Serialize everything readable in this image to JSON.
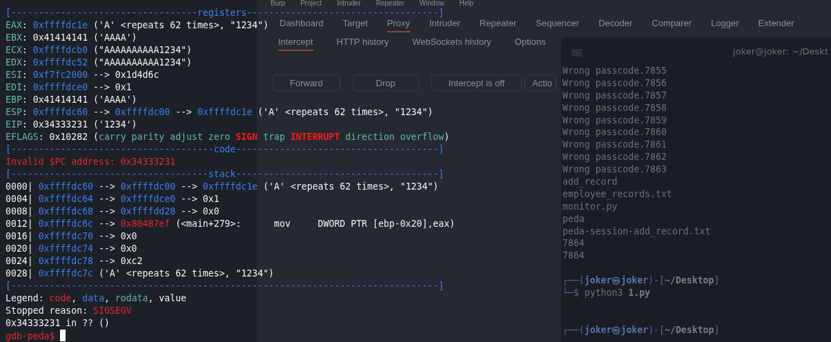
{
  "burp_window": {
    "menu": [
      "Burp",
      "Project",
      "Intruder",
      "Repeater",
      "Window",
      "Help"
    ],
    "tabs": [
      {
        "label": "Dashboard",
        "selected": false
      },
      {
        "label": "Target",
        "selected": false
      },
      {
        "label": "Proxy",
        "selected": true
      },
      {
        "label": "Intruder",
        "selected": false
      },
      {
        "label": "Repeater",
        "selected": false
      },
      {
        "label": "Sequencer",
        "selected": false
      },
      {
        "label": "Decoder",
        "selected": false
      },
      {
        "label": "Comparer",
        "selected": false
      },
      {
        "label": "Logger",
        "selected": false
      },
      {
        "label": "Extender",
        "selected": false
      }
    ],
    "subtabs": [
      {
        "label": "Intercept",
        "selected": true
      },
      {
        "label": "HTTP history",
        "selected": false
      },
      {
        "label": "WebSockets history",
        "selected": false
      },
      {
        "label": "Options",
        "selected": false
      }
    ],
    "buttons": [
      "Forward",
      "Drop",
      "Intercept is off",
      "Actio"
    ]
  },
  "shell_window": {
    "title": "joker@joker: ~/Deskt",
    "blocks": [
      {
        "lines": [
          {
            "segments": [
              {
                "text": "Wrong passcode.7855",
                "kind": "plain"
              }
            ]
          },
          {
            "segments": [
              {
                "text": "Wrong passcode.7856",
                "kind": "plain"
              }
            ]
          },
          {
            "segments": [
              {
                "text": "Wrong passcode.7857",
                "kind": "plain"
              }
            ]
          },
          {
            "segments": [
              {
                "text": "Wrong passcode.7858",
                "kind": "plain"
              }
            ]
          },
          {
            "segments": [
              {
                "text": "Wrong passcode.7859",
                "kind": "plain"
              }
            ]
          },
          {
            "segments": [
              {
                "text": "Wrong passcode.7860",
                "kind": "plain"
              }
            ]
          },
          {
            "segments": [
              {
                "text": "Wrong passcode.7861",
                "kind": "plain"
              }
            ]
          },
          {
            "segments": [
              {
                "text": "Wrong passcode.7862",
                "kind": "plain"
              }
            ]
          },
          {
            "segments": [
              {
                "text": "Wrong passcode.7863",
                "kind": "plain"
              }
            ]
          },
          {
            "segments": [
              {
                "text": "add_record",
                "kind": "plain"
              }
            ]
          },
          {
            "segments": [
              {
                "text": "employee_records.txt",
                "kind": "plain"
              }
            ]
          },
          {
            "segments": [
              {
                "text": "monitor.py",
                "kind": "plain"
              }
            ]
          },
          {
            "segments": [
              {
                "text": "peda",
                "kind": "plain"
              }
            ]
          },
          {
            "segments": [
              {
                "text": "peda-session-add_record.txt",
                "kind": "plain"
              }
            ]
          },
          {
            "segments": [
              {
                "text": "7864",
                "kind": "plain"
              }
            ]
          },
          {
            "segments": [
              {
                "text": "7864",
                "kind": "plain"
              }
            ]
          }
        ]
      },
      {
        "lines": [
          {
            "segments": [
              {
                "text": "┌──(",
                "kind": "prompt"
              },
              {
                "text": "joker㉿joker",
                "kind": "user"
              },
              {
                "text": ")-[",
                "kind": "prompt"
              },
              {
                "text": "~/Desktop",
                "kind": "path"
              },
              {
                "text": "]",
                "kind": "prompt"
              }
            ]
          },
          {
            "segments": [
              {
                "text": "└─$ ",
                "kind": "prompt"
              },
              {
                "text": "python3 ",
                "kind": "plain"
              },
              {
                "text": "1.py",
                "kind": "path"
              }
            ]
          }
        ]
      },
      {
        "lines": [
          {
            "segments": [
              {
                "text": "┌──(",
                "kind": "prompt"
              },
              {
                "text": "joker㉿joker",
                "kind": "user"
              },
              {
                "text": ")-[",
                "kind": "prompt"
              },
              {
                "text": "~/Desktop",
                "kind": "path"
              },
              {
                "text": "]",
                "kind": "prompt"
              }
            ]
          }
        ]
      }
    ]
  },
  "gdb_terminal": {
    "lines": [
      {
        "segments": [
          {
            "text": "[----------------------------------registers-----------------------------------]",
            "kind": "header"
          }
        ]
      },
      {
        "segments": [
          {
            "text": "EAX",
            "kind": "label"
          },
          {
            "text": ": ",
            "kind": "plain"
          },
          {
            "text": "0xffffdc1e",
            "kind": "addr"
          },
          {
            "text": " ('A' <repeats 62 times>, \"1234\")",
            "kind": "plain"
          }
        ]
      },
      {
        "segments": [
          {
            "text": "EBX",
            "kind": "label"
          },
          {
            "text": ": 0x41414141 ('AAAA')",
            "kind": "plain"
          }
        ]
      },
      {
        "segments": [
          {
            "text": "ECX",
            "kind": "label"
          },
          {
            "text": ": ",
            "kind": "plain"
          },
          {
            "text": "0xffffdcb0",
            "kind": "addr"
          },
          {
            "text": " (\"AAAAAAAAAA1234\")",
            "kind": "plain"
          }
        ]
      },
      {
        "segments": [
          {
            "text": "EDX",
            "kind": "label"
          },
          {
            "text": ": ",
            "kind": "plain"
          },
          {
            "text": "0xffffdc52",
            "kind": "addr"
          },
          {
            "text": " (\"AAAAAAAAAA1234\")",
            "kind": "plain"
          }
        ]
      },
      {
        "segments": [
          {
            "text": "ESI",
            "kind": "label"
          },
          {
            "text": ": ",
            "kind": "plain"
          },
          {
            "text": "0xf7fc2000",
            "kind": "addr"
          },
          {
            "text": " --> 0x1d4d6c",
            "kind": "plain"
          }
        ]
      },
      {
        "segments": [
          {
            "text": "EDI",
            "kind": "label"
          },
          {
            "text": ": ",
            "kind": "plain"
          },
          {
            "text": "0xffffdce0",
            "kind": "addr"
          },
          {
            "text": " --> 0x1",
            "kind": "plain"
          }
        ]
      },
      {
        "segments": [
          {
            "text": "EBP",
            "kind": "label"
          },
          {
            "text": ": 0x41414141 ('AAAA')",
            "kind": "plain"
          }
        ]
      },
      {
        "segments": [
          {
            "text": "ESP",
            "kind": "label"
          },
          {
            "text": ": ",
            "kind": "plain"
          },
          {
            "text": "0xffffdc60",
            "kind": "addr"
          },
          {
            "text": " --> ",
            "kind": "plain"
          },
          {
            "text": "0xffffdc00",
            "kind": "addr"
          },
          {
            "text": " --> ",
            "kind": "plain"
          },
          {
            "text": "0xffffdc1e",
            "kind": "addr"
          },
          {
            "text": " ('A' <repeats 62 times>, \"1234\")",
            "kind": "plain"
          }
        ]
      },
      {
        "segments": [
          {
            "text": "EIP",
            "kind": "label"
          },
          {
            "text": ": 0x34333231 ('1234')",
            "kind": "plain"
          }
        ]
      },
      {
        "segments": [
          {
            "text": "EFLAGS",
            "kind": "label"
          },
          {
            "text": ": 0x10282 (",
            "kind": "plain"
          },
          {
            "text": "carry parity adjust zero ",
            "kind": "rodata"
          },
          {
            "text": "SIGN",
            "kind": "flag"
          },
          {
            "text": " trap ",
            "kind": "rodata"
          },
          {
            "text": "INTERRUPT",
            "kind": "flag"
          },
          {
            "text": " direction overflow",
            "kind": "rodata"
          },
          {
            "text": ")",
            "kind": "plain"
          }
        ]
      },
      {
        "segments": [
          {
            "text": "[-------------------------------------code-------------------------------------]",
            "kind": "header"
          }
        ]
      },
      {
        "segments": [
          {
            "text": "Invalid $PC address: 0x34333231",
            "kind": "code"
          }
        ]
      },
      {
        "segments": [
          {
            "text": "[------------------------------------stack-------------------------------------]",
            "kind": "header"
          }
        ]
      },
      {
        "segments": [
          {
            "text": "0000| ",
            "kind": "plain"
          },
          {
            "text": "0xffffdc60",
            "kind": "addr"
          },
          {
            "text": " --> ",
            "kind": "plain"
          },
          {
            "text": "0xffffdc00",
            "kind": "addr"
          },
          {
            "text": " --> ",
            "kind": "plain"
          },
          {
            "text": "0xffffdc1e",
            "kind": "addr"
          },
          {
            "text": " ('A' <repeats 62 times>, \"1234\")",
            "kind": "plain"
          }
        ]
      },
      {
        "segments": [
          {
            "text": "0004| ",
            "kind": "plain"
          },
          {
            "text": "0xffffdc64",
            "kind": "addr"
          },
          {
            "text": " --> ",
            "kind": "plain"
          },
          {
            "text": "0xffffdce0",
            "kind": "addr"
          },
          {
            "text": " --> 0x1",
            "kind": "plain"
          }
        ]
      },
      {
        "segments": [
          {
            "text": "0008| ",
            "kind": "plain"
          },
          {
            "text": "0xffffdc68",
            "kind": "addr"
          },
          {
            "text": " --> ",
            "kind": "plain"
          },
          {
            "text": "0xffffdd28",
            "kind": "addr"
          },
          {
            "text": " --> 0x0",
            "kind": "plain"
          }
        ]
      },
      {
        "segments": [
          {
            "text": "0012| ",
            "kind": "plain"
          },
          {
            "text": "0xffffdc6c",
            "kind": "addr"
          },
          {
            "text": " --> ",
            "kind": "plain"
          },
          {
            "text": "0x80487ef",
            "kind": "code"
          },
          {
            "text": " (<main+279>:      mov     DWORD PTR [ebp-0x20],eax)",
            "kind": "plain"
          }
        ]
      },
      {
        "segments": [
          {
            "text": "0016| ",
            "kind": "plain"
          },
          {
            "text": "0xffffdc70",
            "kind": "addr"
          },
          {
            "text": " --> 0x0",
            "kind": "plain"
          }
        ]
      },
      {
        "segments": [
          {
            "text": "0020| ",
            "kind": "plain"
          },
          {
            "text": "0xffffdc74",
            "kind": "addr"
          },
          {
            "text": " --> 0x0",
            "kind": "plain"
          }
        ]
      },
      {
        "segments": [
          {
            "text": "0024| ",
            "kind": "plain"
          },
          {
            "text": "0xffffdc78",
            "kind": "addr"
          },
          {
            "text": " --> 0xc2",
            "kind": "plain"
          }
        ]
      },
      {
        "segments": [
          {
            "text": "0028| ",
            "kind": "plain"
          },
          {
            "text": "0xffffdc7c",
            "kind": "addr"
          },
          {
            "text": " ('A' <repeats 62 times>, \"1234\")",
            "kind": "plain"
          }
        ]
      },
      {
        "segments": [
          {
            "text": "[------------------------------------------------------------------------------]",
            "kind": "header"
          }
        ]
      },
      {
        "segments": [
          {
            "text": "Legend: ",
            "kind": "plain"
          },
          {
            "text": "code",
            "kind": "code"
          },
          {
            "text": ", ",
            "kind": "plain"
          },
          {
            "text": "data",
            "kind": "addr"
          },
          {
            "text": ", ",
            "kind": "plain"
          },
          {
            "text": "rodata",
            "kind": "rodata"
          },
          {
            "text": ", value",
            "kind": "plain"
          }
        ]
      },
      {
        "segments": [
          {
            "text": "Stopped reason: ",
            "kind": "plain"
          },
          {
            "text": "SIGSEGV",
            "kind": "code"
          }
        ]
      },
      {
        "segments": [
          {
            "text": "0x34333231 in ?? ()",
            "kind": "plain"
          }
        ]
      },
      {
        "segments": [
          {
            "text": "gdb-peda$ ",
            "kind": "code"
          }
        ],
        "cursor": true
      }
    ]
  }
}
